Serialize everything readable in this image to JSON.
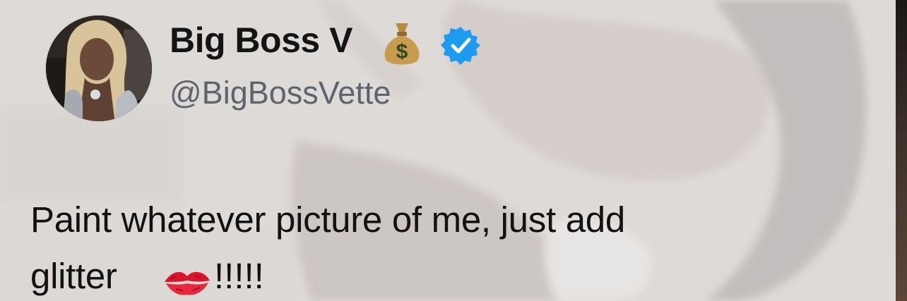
{
  "tweet": {
    "author": {
      "display_name": "Big Boss V",
      "handle": "@BigBossVette",
      "name_emoji": "money-bag-icon",
      "verified": true,
      "verified_color": "#1d9bf0"
    },
    "text_line_1": "Paint whatever picture of me, just add",
    "text_line_2": "glitter",
    "text_emoji": "kiss-mark-icon",
    "text_tail": "!!!!!"
  }
}
